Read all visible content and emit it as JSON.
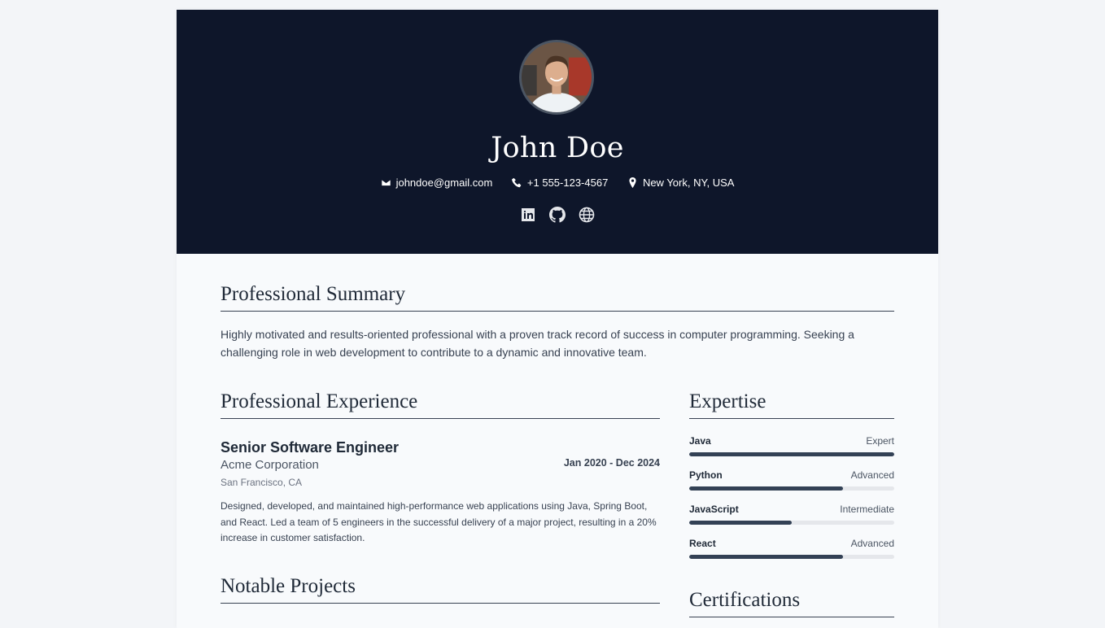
{
  "header": {
    "name": "John Doe",
    "contacts": {
      "email": "johndoe@gmail.com",
      "phone": "+1 555-123-4567",
      "location": "New York, NY, USA"
    },
    "socials": [
      "linkedin-icon",
      "github-icon",
      "globe-icon"
    ]
  },
  "summary": {
    "title": "Professional Summary",
    "text": "Highly motivated and results-oriented professional with a proven track record of success in computer programming. Seeking a challenging role in web development to contribute to a dynamic and innovative team."
  },
  "experience": {
    "title": "Professional Experience",
    "jobs": [
      {
        "title": "Senior Software Engineer",
        "company": "Acme Corporation",
        "location": "San Francisco, CA",
        "dates": "Jan 2020 - Dec 2024",
        "description": "Designed, developed, and maintained high-performance web applications using Java, Spring Boot, and React. Led a team of 5 engineers in the successful delivery of a major project, resulting in a 20% increase in customer satisfaction."
      }
    ]
  },
  "projects": {
    "title": "Notable Projects"
  },
  "expertise": {
    "title": "Expertise",
    "skills": [
      {
        "name": "Java",
        "level": "Expert",
        "progress": 1.0
      },
      {
        "name": "Python",
        "level": "Advanced",
        "progress": 0.75
      },
      {
        "name": "JavaScript",
        "level": "Intermediate",
        "progress": 0.5
      },
      {
        "name": "React",
        "level": "Advanced",
        "progress": 0.75
      }
    ]
  },
  "certifications": {
    "title": "Certifications"
  },
  "colors": {
    "header_bg": "#0e162a",
    "accent": "#334155"
  }
}
